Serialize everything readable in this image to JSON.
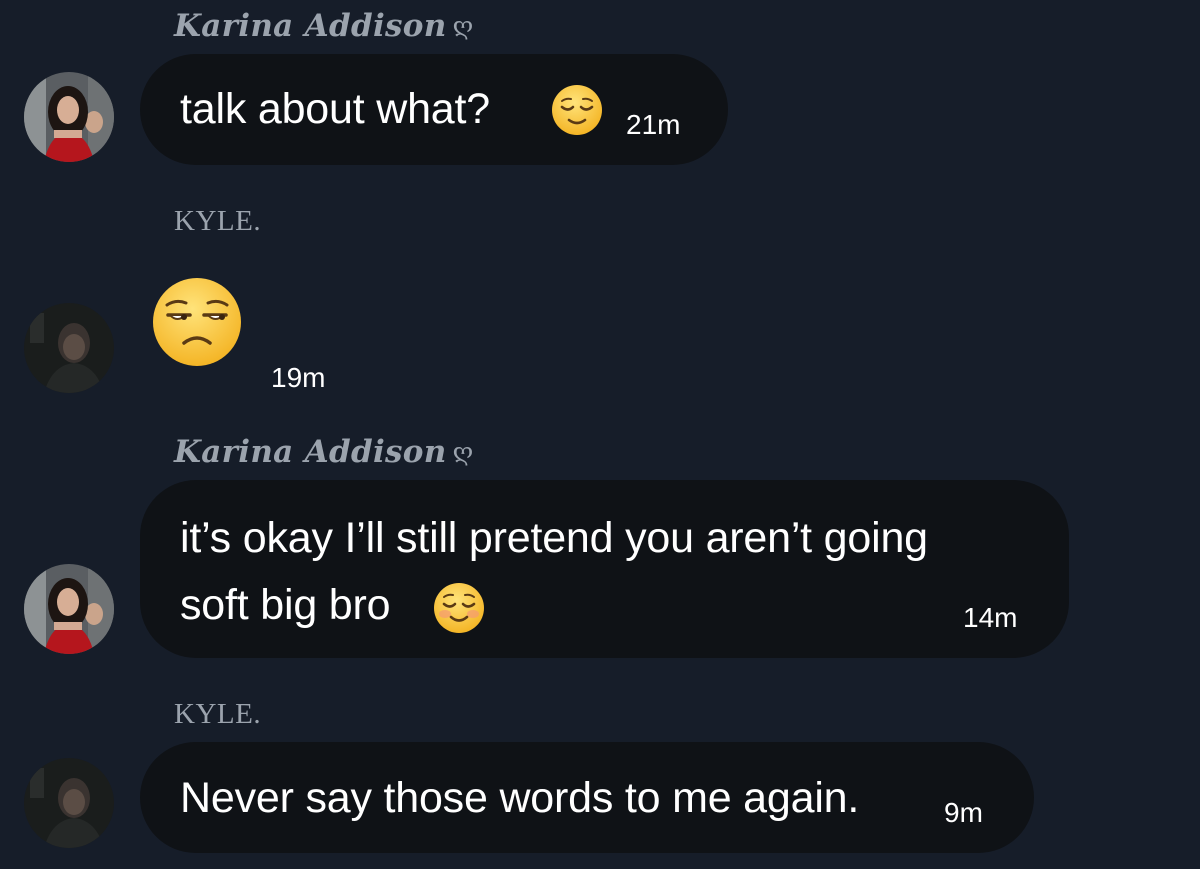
{
  "messages": [
    {
      "sender": "Karina Addison",
      "sender_glyph": "ღ",
      "text": "talk about what?",
      "emoji": "relieved-face",
      "time": "21m"
    },
    {
      "sender": "KYLE.",
      "text": "",
      "emoji": "unamused-face",
      "time": "19m"
    },
    {
      "sender": "Karina Addison",
      "sender_glyph": "ღ",
      "text_line1": "it’s okay I’ll still pretend you aren’t going",
      "text_line2": "soft big bro",
      "emoji": "smiling-face",
      "time": "14m"
    },
    {
      "sender": "KYLE.",
      "text": "Never say those words to me again.",
      "time": "9m"
    }
  ],
  "colors": {
    "background": "#161d29",
    "bubble": "#0f1216",
    "name": "#9ba3ad",
    "text": "#ffffff"
  }
}
